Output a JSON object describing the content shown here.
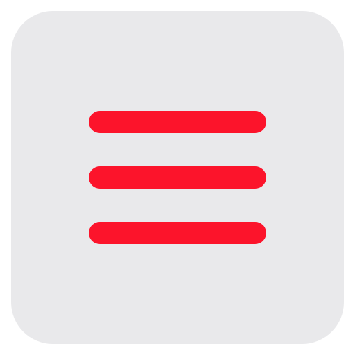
{
  "icon": {
    "name": "hamburger-menu-icon",
    "tile_color": "#e9e9eb",
    "bar_color": "#fc142b",
    "bars": [
      "top",
      "middle",
      "bottom"
    ]
  }
}
